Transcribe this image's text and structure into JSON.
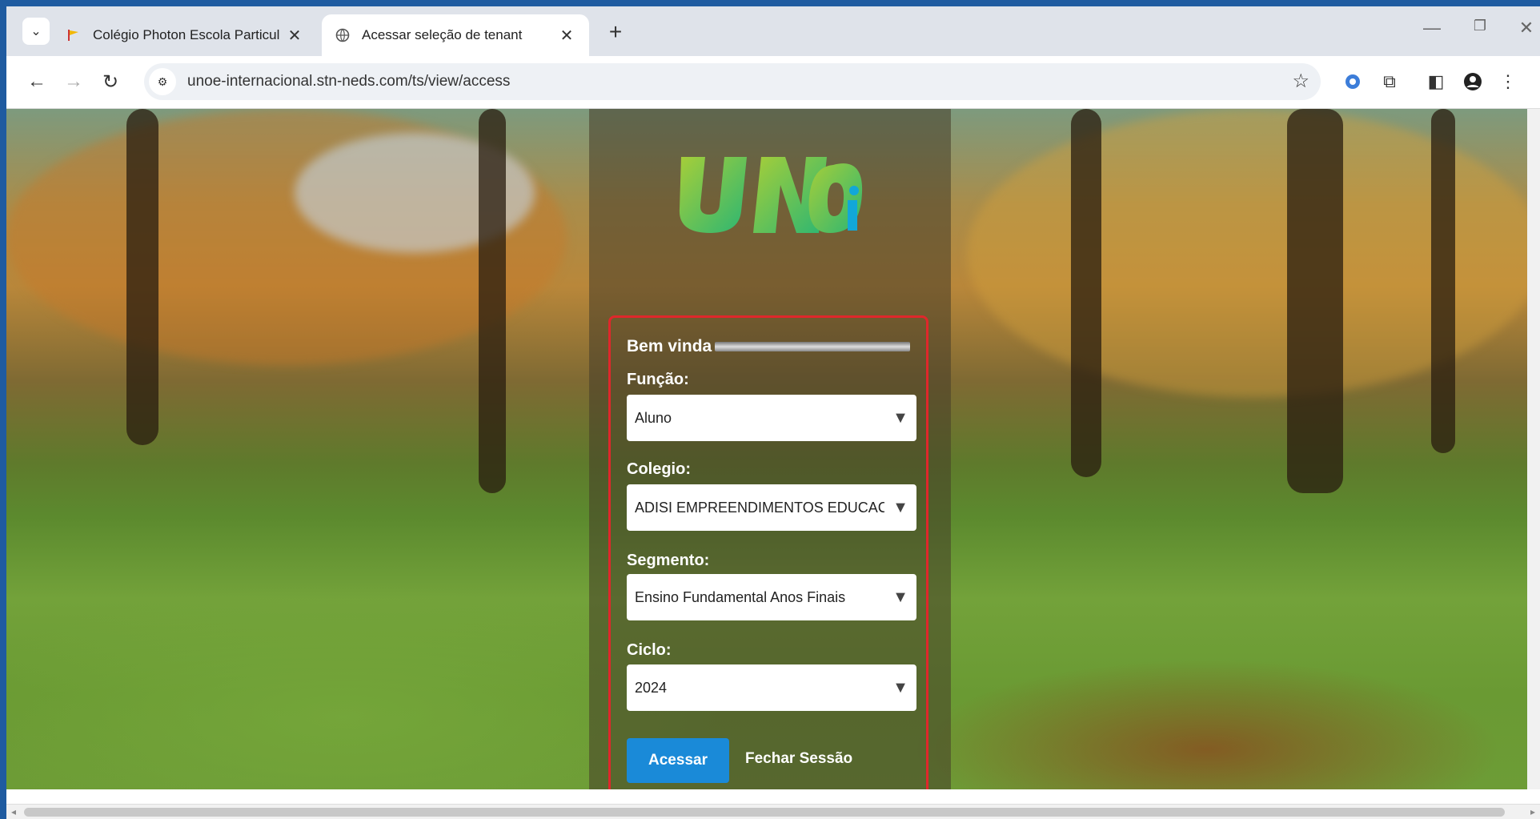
{
  "browser": {
    "tabs": [
      {
        "title": "Colégio Photon Escola Particul",
        "active": false,
        "icon": "school-flag-icon"
      },
      {
        "title": "Acessar seleção de tenant",
        "active": true,
        "icon": "globe-icon"
      }
    ],
    "new_tab_label": "+",
    "url": "unoe-internacional.stn-neds.com/ts/view/access"
  },
  "page": {
    "logo_text": "UNOi",
    "welcome": "Bem vinda",
    "fields": {
      "funcao": {
        "label": "Função:",
        "value": "Aluno"
      },
      "colegio": {
        "label": "Colegio:",
        "value": "ADISI EMPREENDIMENTOS EDUCACIONAIS"
      },
      "segmento": {
        "label": "Segmento:",
        "value": "Ensino Fundamental Anos Finais"
      },
      "ciclo": {
        "label": "Ciclo:",
        "value": "2024"
      }
    },
    "buttons": {
      "acessar": "Acessar",
      "fechar": "Fechar Sessão"
    }
  },
  "colors": {
    "accent": "#1a8ad8",
    "highlight_border": "#e0272b",
    "logo_green": "#7bc043",
    "logo_cyan": "#12a7d8"
  }
}
